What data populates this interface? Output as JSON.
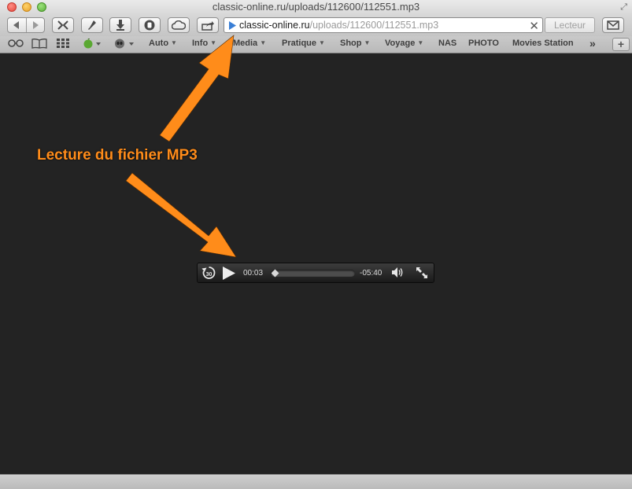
{
  "window": {
    "title": "classic-online.ru/uploads/112600/112551.mp3"
  },
  "toolbar": {
    "back_icon": "back-arrow-icon",
    "forward_icon": "forward-arrow-icon",
    "url_host": "classic-online.ru",
    "url_path": "/uploads/112600/112551.mp3",
    "reader_label": "Lecteur"
  },
  "bookmarks": {
    "items": [
      {
        "label": "Auto"
      },
      {
        "label": "Info"
      },
      {
        "label": "Media"
      },
      {
        "label": "Pratique"
      },
      {
        "label": "Shop"
      },
      {
        "label": "Voyage"
      },
      {
        "label": "NAS"
      },
      {
        "label": "PHOTO"
      },
      {
        "label": "Movies Station"
      }
    ],
    "overflow": "»",
    "new_tab": "+"
  },
  "annotation": {
    "text": "Lecture du fichier MP3",
    "color": "#ff8c1a"
  },
  "player": {
    "skip_back_label": "30",
    "elapsed": "00:03",
    "remaining": "-05:40",
    "progress_fraction": 0.01
  },
  "colors": {
    "content_bg": "#232323",
    "accent_arrow": "#ff8c1a"
  }
}
